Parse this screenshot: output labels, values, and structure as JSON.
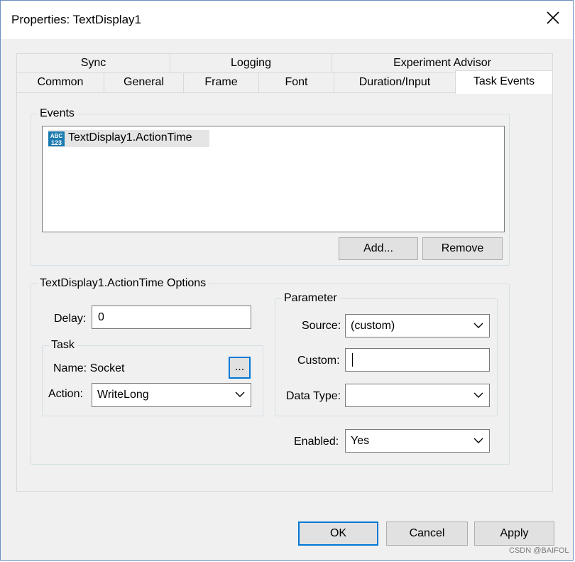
{
  "window": {
    "title": "Properties: TextDisplay1",
    "close_icon": "close-icon"
  },
  "tabs": {
    "row1": [
      {
        "label": "Sync"
      },
      {
        "label": "Logging"
      },
      {
        "label": "Experiment Advisor"
      }
    ],
    "row2": [
      {
        "label": "Common"
      },
      {
        "label": "General"
      },
      {
        "label": "Frame"
      },
      {
        "label": "Font"
      },
      {
        "label": "Duration/Input"
      },
      {
        "label": "Task Events",
        "active": true
      }
    ]
  },
  "events": {
    "group_label": "Events",
    "items": [
      {
        "label": "TextDisplay1.ActionTime",
        "icon": "abc-123-icon",
        "selected": true
      }
    ],
    "add_button": "Add...",
    "remove_button": "Remove"
  },
  "options": {
    "group_label": "TextDisplay1.ActionTime Options",
    "delay_label": "Delay:",
    "delay_value": "0",
    "task": {
      "group_label": "Task",
      "name_label": "Name: Socket",
      "browse_button": "...",
      "action_label": "Action:",
      "action_value": "WriteLong"
    },
    "parameter": {
      "group_label": "Parameter",
      "source_label": "Source:",
      "source_value": "(custom)",
      "custom_label": "Custom:",
      "custom_value": "",
      "data_type_label": "Data Type:",
      "data_type_value": ""
    },
    "enabled_label": "Enabled:",
    "enabled_value": "Yes"
  },
  "footer": {
    "ok_button": "OK",
    "cancel_button": "Cancel",
    "apply_button": "Apply",
    "watermark": "CSDN @BAIFOL"
  }
}
